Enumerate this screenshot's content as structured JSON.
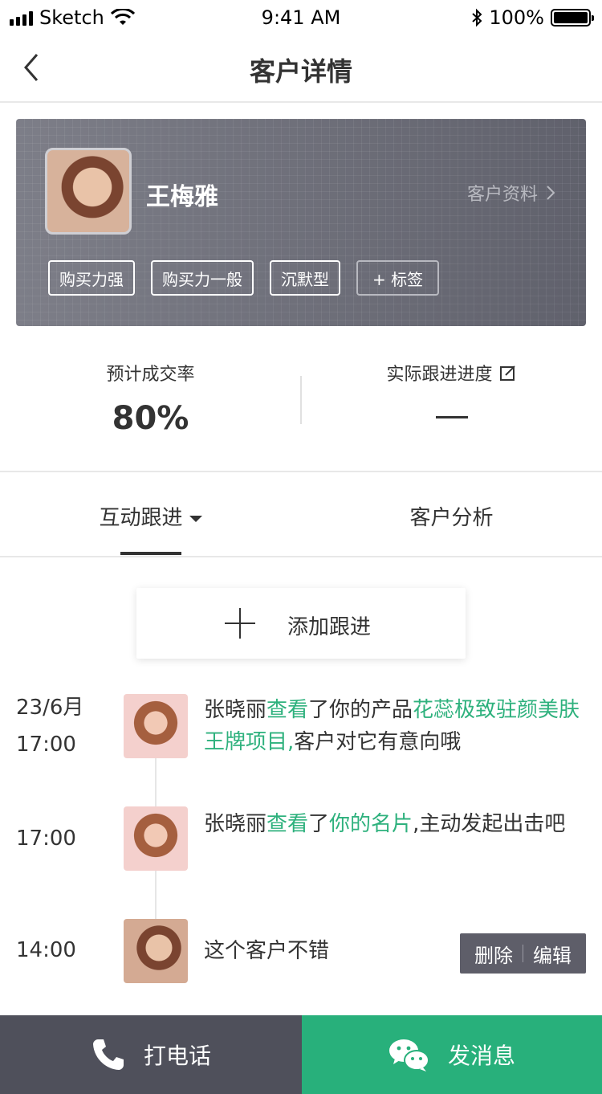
{
  "status_bar": {
    "carrier": "Sketch",
    "time": "9:41 AM",
    "battery": "100%",
    "icons": [
      "signal-icon",
      "wifi-icon",
      "bluetooth-icon",
      "battery-icon"
    ]
  },
  "nav": {
    "title": "客户详情",
    "back_icon": "chevron-left-icon"
  },
  "customer": {
    "name": "王梅雅",
    "profile_link": "客户资料",
    "tags": [
      "购买力强",
      "购买力一般",
      "沉默型"
    ],
    "add_tag_label": "+ 标签"
  },
  "stats": {
    "expected_label": "预计成交率",
    "expected_value": "80%",
    "actual_label": "实际跟进进度",
    "actual_value": "—"
  },
  "tabs": {
    "interaction": "互动跟进",
    "analysis": "客户分析"
  },
  "add_follow_label": "添加跟进",
  "timeline": [
    {
      "date": "23/6月",
      "time": "17:00",
      "parts": [
        "张晓丽",
        "查看",
        "了你的产品",
        "花蕊极致驻颜美肤王牌项目,",
        "客户对它有意向哦"
      ]
    },
    {
      "time": "17:00",
      "parts": [
        "张晓丽",
        "查看",
        "了",
        "你的名片",
        ",主动发起出击吧"
      ]
    },
    {
      "time": "14:00",
      "text": "这个客户不错",
      "delete_label": "删除",
      "edit_label": "编辑"
    }
  ],
  "bottom_bar": {
    "call_label": "打电话",
    "message_label": "发消息"
  },
  "colors": {
    "accent_green": "#2eb17d",
    "button_dark": "#4f505b",
    "button_green": "#28b07b"
  }
}
